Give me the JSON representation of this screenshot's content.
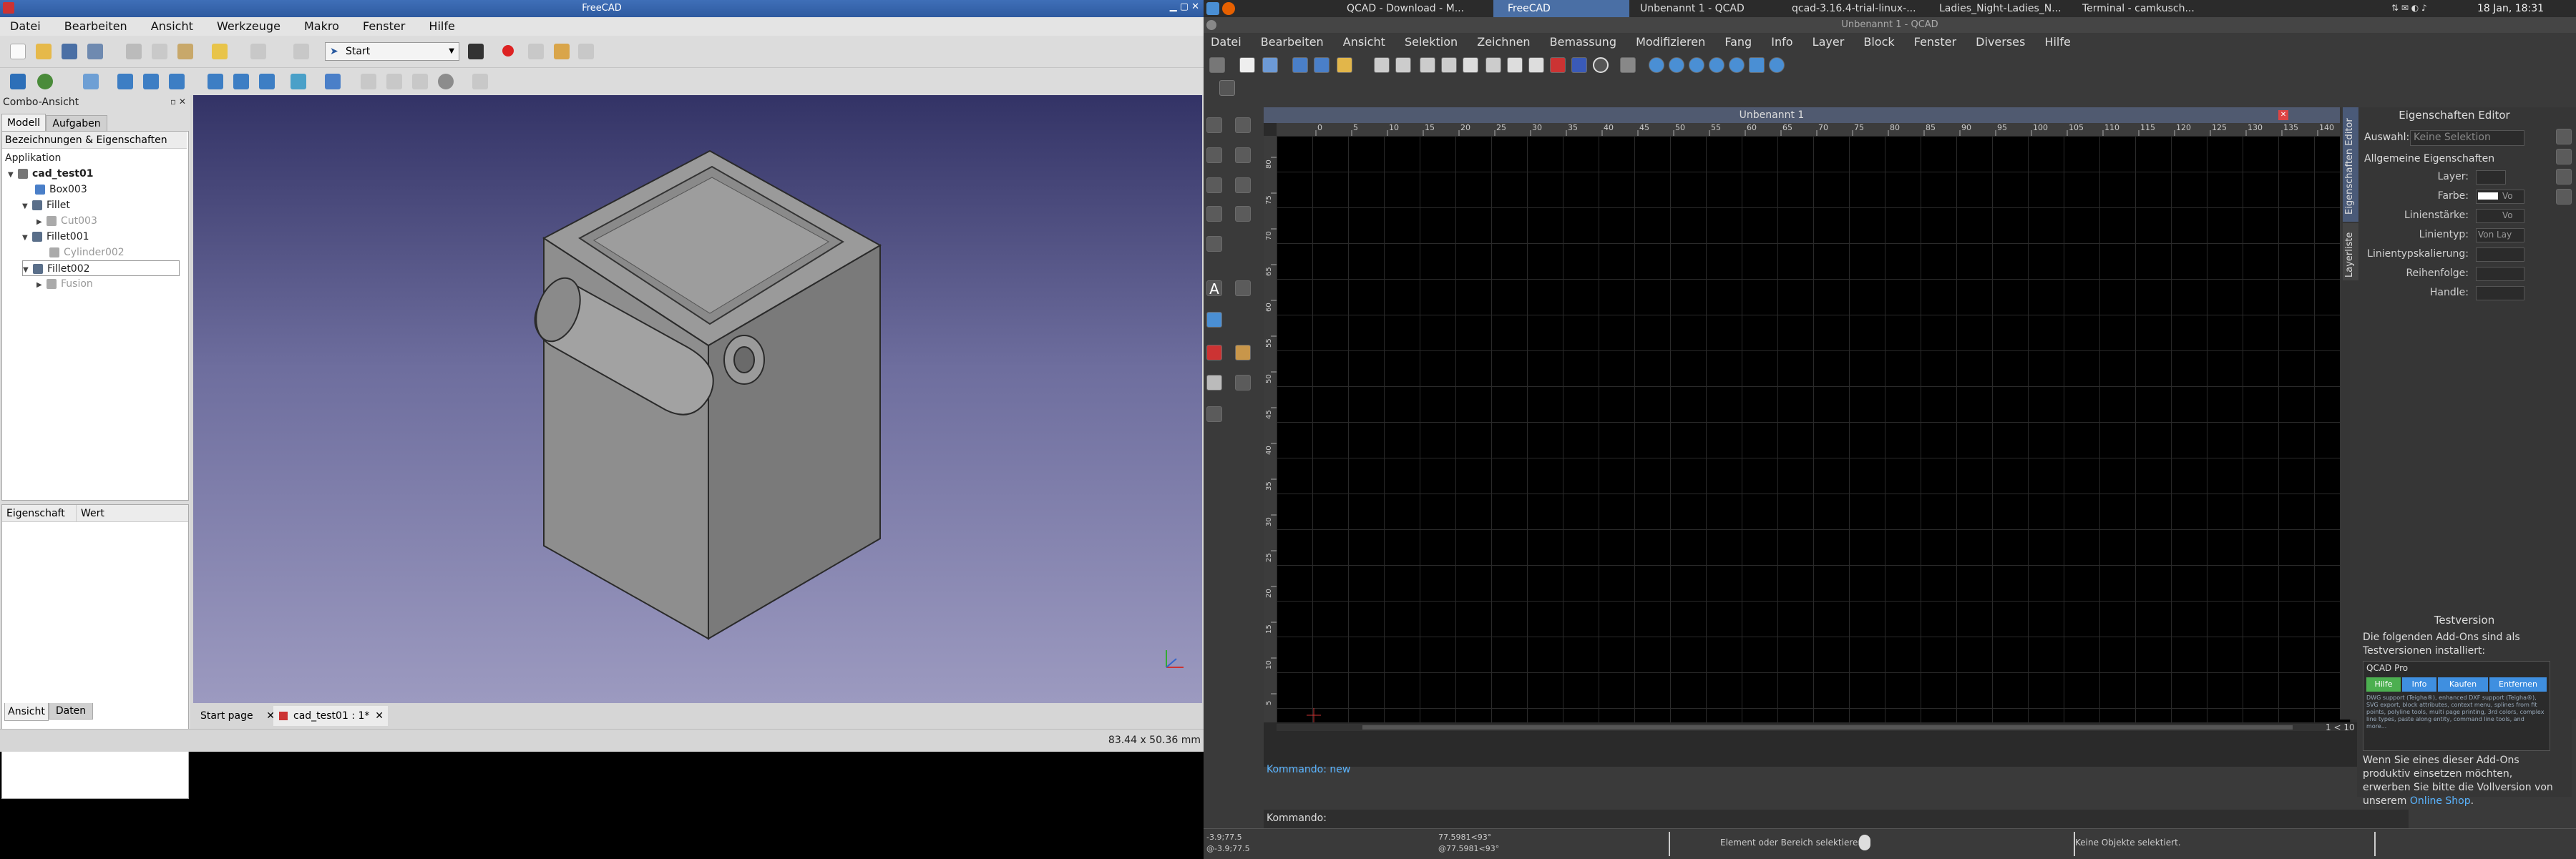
{
  "desktop": {
    "taskbar": {
      "items": [
        {
          "label": "QCAD - Download - M..."
        },
        {
          "label": "FreeCAD"
        },
        {
          "label": "Unbenannt 1 - QCAD"
        },
        {
          "label": "qcad-3.16.4-trial-linux-..."
        },
        {
          "label": "Ladies_Night-Ladies_N..."
        },
        {
          "label": "Terminal - camkusch..."
        }
      ],
      "clock": "18 Jan, 18:31"
    }
  },
  "freecad": {
    "title": "FreeCAD",
    "menu": [
      "Datei",
      "Bearbeiten",
      "Ansicht",
      "Werkzeuge",
      "Makro",
      "Fenster",
      "Hilfe"
    ],
    "workbench": "Start",
    "combo": {
      "title": "Combo-Ansicht",
      "tabs": [
        "Modell",
        "Aufgaben"
      ],
      "header": "Bezeichnungen & Eigenschaften",
      "tree": [
        {
          "label": "Applikation",
          "level": 0
        },
        {
          "label": "cad_test01",
          "level": 0
        },
        {
          "label": "Box003",
          "level": 1
        },
        {
          "label": "Fillet",
          "level": 1
        },
        {
          "label": "Cut003",
          "level": 2
        },
        {
          "label": "Fillet001",
          "level": 1
        },
        {
          "label": "Cylinder002",
          "level": 2
        },
        {
          "label": "Fillet002",
          "level": 1
        },
        {
          "label": "Fusion",
          "level": 2
        }
      ],
      "prop_headers": [
        "Eigenschaft",
        "Wert"
      ],
      "bottom_tabs": [
        "Ansicht",
        "Daten"
      ]
    },
    "doc_tabs": [
      "Start page",
      "cad_test01 : 1*"
    ],
    "status": "83.44 x 50.36 mm",
    "colors": {
      "bg_top": "#333366",
      "bg_bottom": "#9c9ac0",
      "model": "#8a8a8a"
    }
  },
  "qcad": {
    "title": "Unbenannt 1 - QCAD",
    "menu": [
      "Datei",
      "Bearbeiten",
      "Ansicht",
      "Selektion",
      "Zeichnen",
      "Bemassung",
      "Modifizieren",
      "Fang",
      "Info",
      "Layer",
      "Block",
      "Fenster",
      "Diverses",
      "Hilfe"
    ],
    "doc_title": "Unbenannt 1",
    "ruler_x": [
      "0",
      "5",
      "10",
      "15",
      "20",
      "25",
      "30",
      "35",
      "40",
      "45",
      "50",
      "55",
      "60",
      "65",
      "70",
      "75",
      "80",
      "85",
      "90",
      "95",
      "100",
      "105",
      "110",
      "115",
      "120",
      "125",
      "130",
      "135",
      "140"
    ],
    "ruler_y": [
      "80",
      "75",
      "70",
      "65",
      "60",
      "55",
      "50",
      "45",
      "40",
      "35",
      "30",
      "25",
      "20",
      "15",
      "10",
      "5"
    ],
    "scale": "1 < 10",
    "command_history": "Kommando: new",
    "command_label": "Kommando:",
    "props": {
      "title": "Eigenschaften Editor",
      "side_tabs": [
        "Eigenschaften Editor",
        "Layerliste"
      ],
      "selection_label": "Auswahl:",
      "selection_value": "Keine Selektion",
      "group": "Allgemeine Eigenschaften",
      "fields": [
        {
          "label": "Layer:",
          "value": ""
        },
        {
          "label": "Farbe:",
          "value": "Vo"
        },
        {
          "label": "Linienstärke:",
          "value": "Vo"
        },
        {
          "label": "Linientyp:",
          "value": "Von Lay"
        },
        {
          "label": "Linientypskalierung:",
          "value": ""
        },
        {
          "label": "Reihenfolge:",
          "value": ""
        },
        {
          "label": "Handle:",
          "value": ""
        }
      ]
    },
    "trial": {
      "title": "Testversion",
      "text1": "Die folgenden Add-Ons sind als Testversionen installiert:",
      "addon": "QCAD Pro",
      "buttons": [
        "Hilfe",
        "Info",
        "Kaufen",
        "Entfernen"
      ],
      "desc": "DWG support (Teigha®), enhanced DXF support (Teigha®), SVG export, block attributes, context menu, splines from fit points, polyline tools, multi page printing, 3rd colors, complex line types, paste along entity, command line tools, and more...",
      "text2a": "Wenn Sie eines dieser Add-Ons produktiv einsetzen möchten, erwerben Sie bitte die Vollversion von unserem ",
      "link": "Online Shop",
      "text2b": "."
    },
    "status": {
      "coord1a": "-3.9;77.5",
      "coord1b": "@-3.9;77.5",
      "coord2a": "77.5981<93°",
      "coord2b": "@77.5981<93°",
      "hint": "Element oder Bereich selektieren",
      "selection": "Keine Objekte selektiert."
    }
  }
}
